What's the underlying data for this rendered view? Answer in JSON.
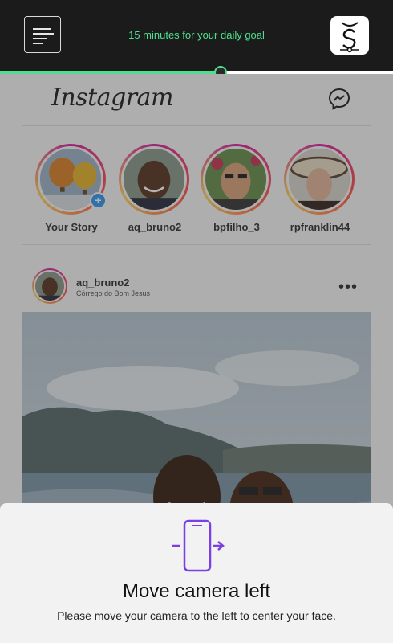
{
  "topbar": {
    "goal_text": "15  minutes for your daily goal",
    "menu_icon": "menu-lines-icon",
    "logo_icon": "app-logo-icon",
    "progress": 0.56,
    "accent": "#4fe08f"
  },
  "instagram": {
    "logo": "Instagram",
    "messenger_icon": "messenger-icon",
    "stories": [
      {
        "name": "Your Story"
      },
      {
        "name": "aq_bruno2"
      },
      {
        "name": "bpfilho_3"
      },
      {
        "name": "rpfranklin44"
      }
    ],
    "post": {
      "user": "aq_bruno2",
      "location": "Córrego do Bom Jesus",
      "more": "•••"
    }
  },
  "sheet": {
    "icon": "phone-move-right-icon",
    "title": "Move camera left",
    "message": "Please move your camera to the left to center your face."
  }
}
